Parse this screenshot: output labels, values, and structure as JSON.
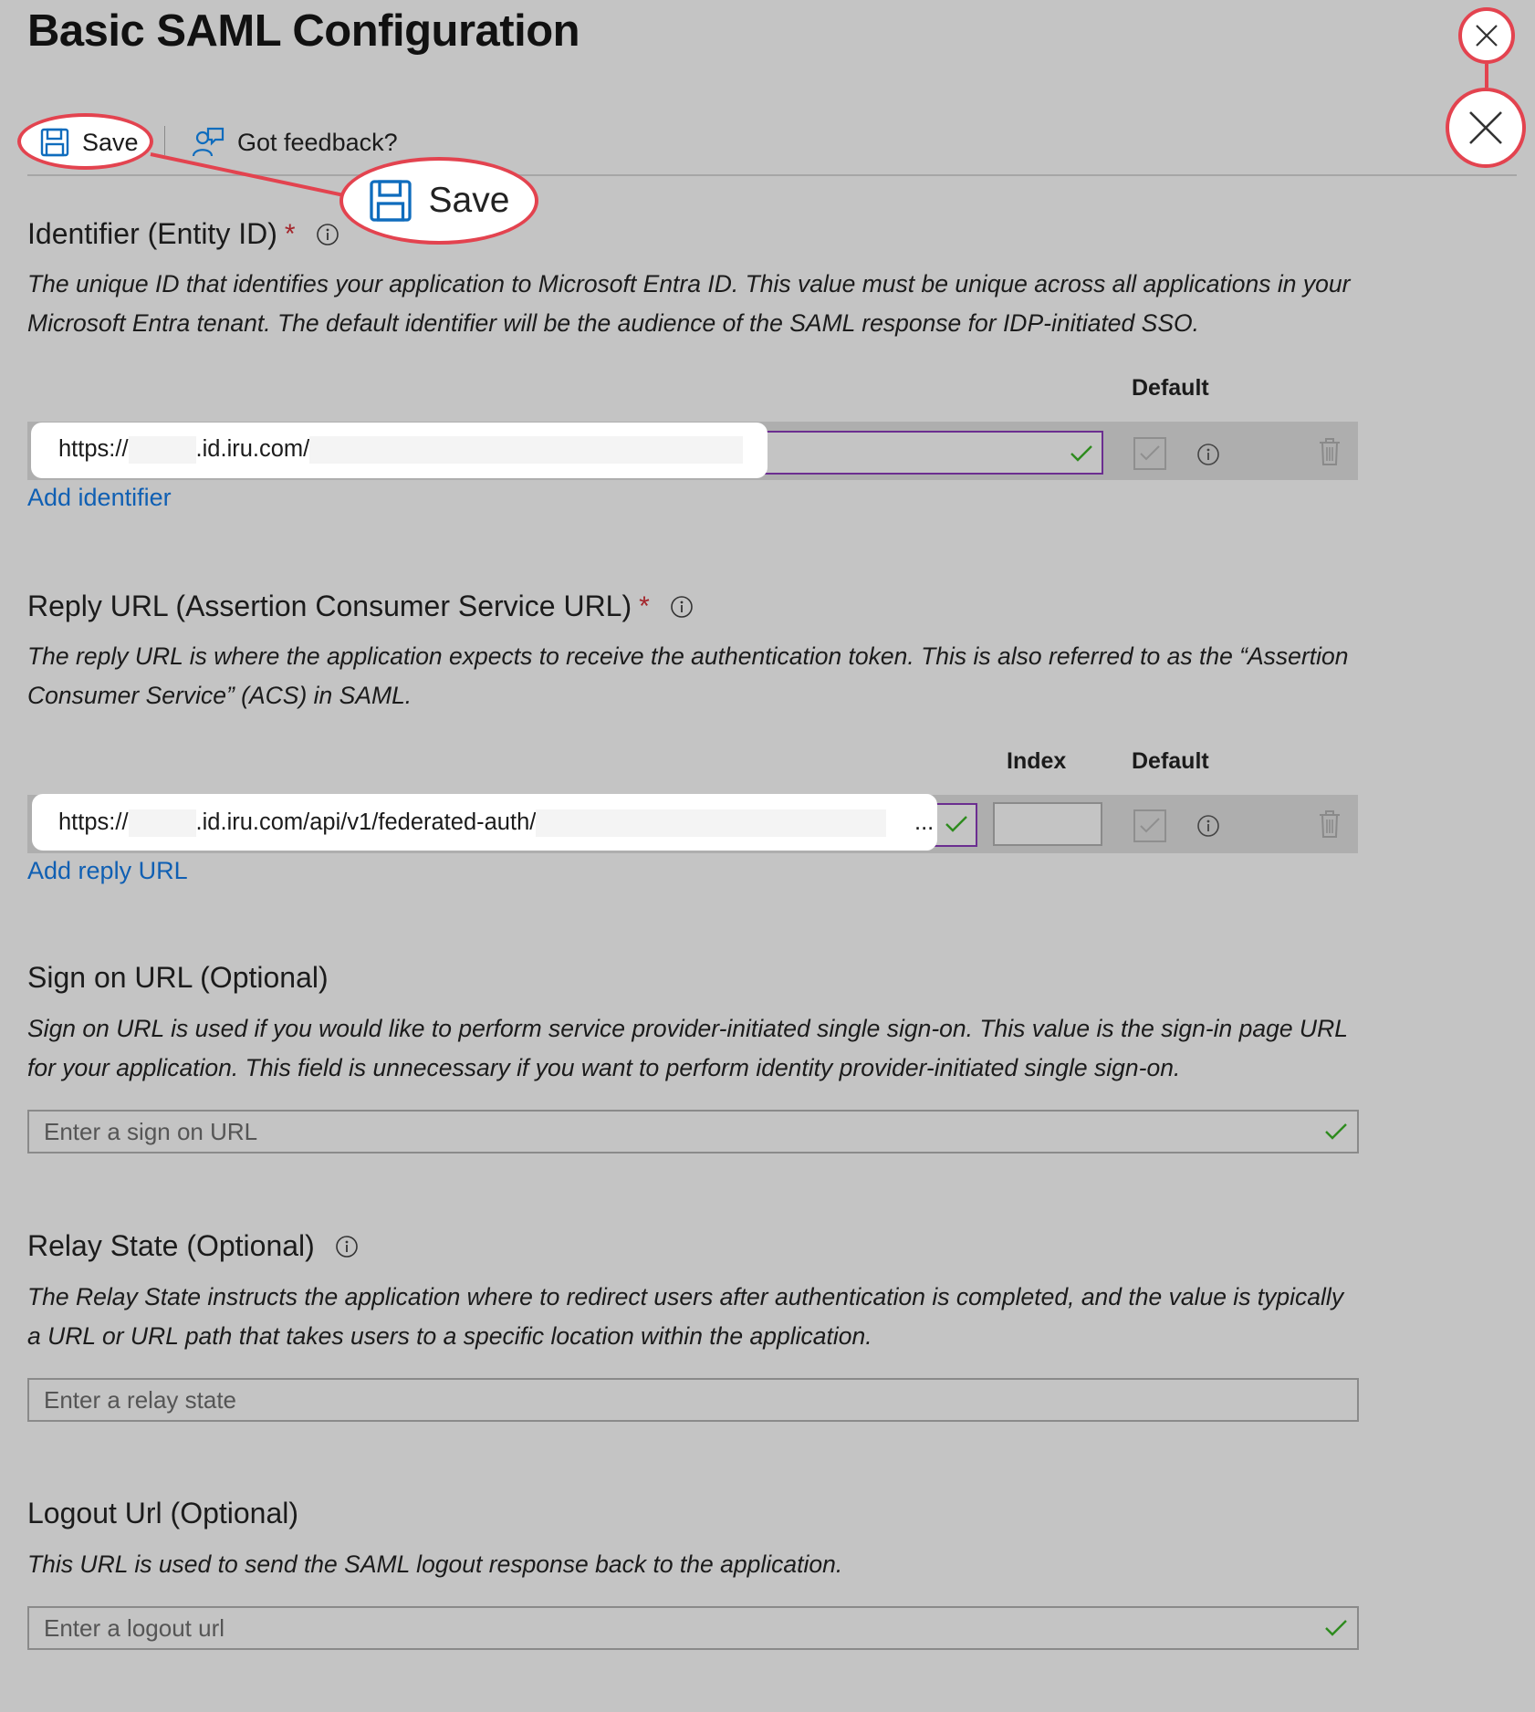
{
  "page": {
    "title": "Basic SAML Configuration"
  },
  "toolbar": {
    "save_label": "Save",
    "feedback_label": "Got feedback?"
  },
  "callout": {
    "save_label": "Save"
  },
  "identifier": {
    "label": "Identifier (Entity ID)",
    "required_mark": "*",
    "description": "The unique ID that identifies your application to Microsoft Entra ID. This value must be unique across all applications in your Microsoft Entra tenant. The default identifier will be the audience of the SAML response for IDP-initiated SSO.",
    "default_header": "Default",
    "value_prefix": "https://",
    "value_middle": ".id.iru.com/",
    "add_link": "Add identifier"
  },
  "reply_url": {
    "label": "Reply URL (Assertion Consumer Service URL)",
    "required_mark": "*",
    "description": "The reply URL is where the application expects to receive the authentication token. This is also referred to as the “Assertion Consumer Service” (ACS) in SAML.",
    "index_header": "Index",
    "default_header": "Default",
    "value_prefix": "https://",
    "value_middle": ".id.iru.com/api/v1/federated-auth/",
    "value_ellipsis": "...",
    "add_link": "Add reply URL"
  },
  "sign_on": {
    "label": "Sign on URL (Optional)",
    "description": "Sign on URL is used if you would like to perform service provider-initiated single sign-on. This value is the sign-in page URL for your application. This field is unnecessary if you want to perform identity provider-initiated single sign-on.",
    "placeholder": "Enter a sign on URL"
  },
  "relay_state": {
    "label": "Relay State (Optional)",
    "description": "The Relay State instructs the application where to redirect users after authentication is completed, and the value is typically a URL or URL path that takes users to a specific location within the application.",
    "placeholder": "Enter a relay state"
  },
  "logout": {
    "label": "Logout Url (Optional)",
    "description": "This URL is used to send the SAML logout response back to the application.",
    "placeholder": "Enter a logout url"
  },
  "colors": {
    "accent_link": "#0f5fb3",
    "callout_red": "#e3434f",
    "valid_check": "#2e8b1e",
    "required": "#a4262c",
    "input_focus": "#6b2e90"
  },
  "icons": [
    "save-icon",
    "feedback-icon",
    "close-icon",
    "info-icon",
    "checkmark-icon",
    "checkbox-icon",
    "trash-icon"
  ]
}
